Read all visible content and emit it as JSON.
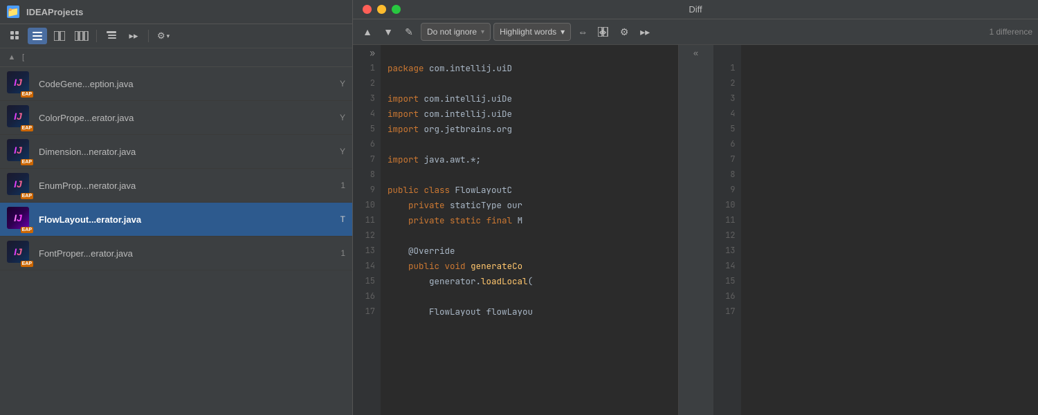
{
  "leftPanel": {
    "title": "IDEAProjects",
    "toolbar": {
      "btn1": "⊞",
      "btn2": "☰",
      "btn3": "⊟",
      "btn4": "⊞⊞",
      "btn5": "⊞",
      "btn6": "▸▸",
      "gearBtn": "⚙",
      "gearChevron": "▾"
    },
    "listHeader": {
      "arrowUp": "▲",
      "colLabel": "["
    },
    "files": [
      {
        "name": "CodeGene...eption.java",
        "badge": "Y",
        "selected": false
      },
      {
        "name": "ColorPrope...erator.java",
        "badge": "Y",
        "selected": false
      },
      {
        "name": "Dimension...nerator.java",
        "badge": "Y",
        "selected": false
      },
      {
        "name": "EnumProp...nerator.java",
        "badge": "1",
        "selected": false
      },
      {
        "name": "FlowLayout...erator.java",
        "badge": "T",
        "selected": true
      },
      {
        "name": "FontProper...erator.java",
        "badge": "1",
        "selected": false
      }
    ]
  },
  "diffPanel": {
    "title": "Diff",
    "trafficLights": [
      "red",
      "yellow",
      "green"
    ],
    "toolbar": {
      "prevBtn": "▲",
      "nextBtn": "▼",
      "editBtn": "✎",
      "ignoreDropdown": "Do not ignore",
      "ignoreChevron": "▾",
      "highlightDropdown": "Highlight words",
      "highlightChevron": "▾",
      "collapseBtn": "⇔",
      "sideBySideBtn": "⧉",
      "settingsBtn": "⚙",
      "moreBtn": "▸▸",
      "diffCount": "1 difference"
    },
    "leftCode": {
      "expandIcon": "»",
      "lines": [
        {
          "num": 1,
          "text": "package com.intellij.uiD"
        },
        {
          "num": 2,
          "text": ""
        },
        {
          "num": 3,
          "text": "import com.intellij.uiDe"
        },
        {
          "num": 4,
          "text": "import com.intellij.uiDe"
        },
        {
          "num": 5,
          "text": "import org.jetbrains.org"
        },
        {
          "num": 6,
          "text": ""
        },
        {
          "num": 7,
          "text": "import java.awt.*;"
        },
        {
          "num": 8,
          "text": ""
        },
        {
          "num": 9,
          "text": "public class FlowLayoutC"
        },
        {
          "num": 10,
          "text": "    private staticType our"
        },
        {
          "num": 11,
          "text": "    private static final M"
        },
        {
          "num": 12,
          "text": ""
        },
        {
          "num": 13,
          "text": "    @Override"
        },
        {
          "num": 14,
          "text": "    public void generateCo"
        },
        {
          "num": 15,
          "text": "        generator.loadLocal("
        },
        {
          "num": 16,
          "text": ""
        },
        {
          "num": 17,
          "text": "        FlowLayout flowLayou"
        }
      ]
    },
    "rightCode": {
      "collapseIcon": "«",
      "lines": [
        {
          "num": 1,
          "text": ""
        },
        {
          "num": 2,
          "text": ""
        },
        {
          "num": 3,
          "text": ""
        },
        {
          "num": 4,
          "text": ""
        },
        {
          "num": 5,
          "text": ""
        },
        {
          "num": 6,
          "text": ""
        },
        {
          "num": 7,
          "text": ""
        },
        {
          "num": 8,
          "text": ""
        },
        {
          "num": 9,
          "text": ""
        },
        {
          "num": 10,
          "text": ""
        },
        {
          "num": 11,
          "text": ""
        },
        {
          "num": 12,
          "text": ""
        },
        {
          "num": 13,
          "text": ""
        },
        {
          "num": 14,
          "text": ""
        },
        {
          "num": 15,
          "text": ""
        },
        {
          "num": 16,
          "text": ""
        },
        {
          "num": 17,
          "text": ""
        }
      ]
    }
  }
}
